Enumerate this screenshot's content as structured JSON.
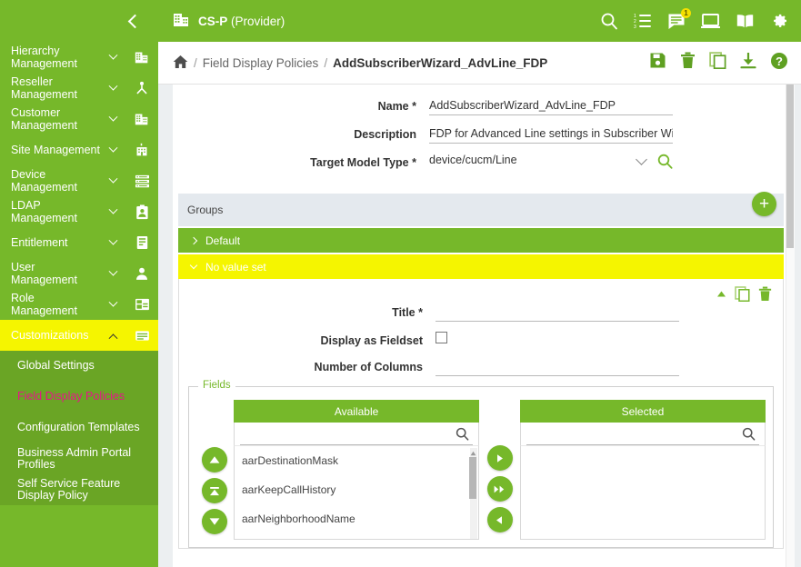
{
  "sidebar": {
    "collapse_icon": "chevron-left-icon",
    "items": [
      {
        "label": "Hierarchy Management",
        "icon": "building-grid-icon",
        "caret": "chevron-down-icon",
        "active": false
      },
      {
        "label": "Reseller Management",
        "icon": "org-tree-icon",
        "caret": "chevron-down-icon",
        "active": false
      },
      {
        "label": "Customer Management",
        "icon": "building-grid-icon",
        "caret": "chevron-down-icon",
        "active": false
      },
      {
        "label": "Site Management",
        "icon": "site-building-icon",
        "caret": "chevron-down-icon",
        "active": false
      },
      {
        "label": "Device Management",
        "icon": "server-list-icon",
        "caret": "chevron-down-icon",
        "active": false
      },
      {
        "label": "LDAP Management",
        "icon": "contact-card-icon",
        "caret": "chevron-down-icon",
        "active": false
      },
      {
        "label": "Entitlement",
        "icon": "entitlement-card-icon",
        "caret": "chevron-down-icon",
        "active": false
      },
      {
        "label": "User Management",
        "icon": "user-icon",
        "caret": "chevron-down-icon",
        "active": false
      },
      {
        "label": "Role Management",
        "icon": "role-window-icon",
        "caret": "chevron-down-icon",
        "active": false
      },
      {
        "label": "Customizations",
        "icon": "customizations-icon",
        "caret": "chevron-up-icon",
        "active": true
      }
    ],
    "subitems": [
      {
        "label": "Global Settings",
        "selected": false
      },
      {
        "label": "Field Display Policies",
        "selected": true
      },
      {
        "label": "Configuration Templates",
        "selected": false
      },
      {
        "label": "Business Admin Portal Profiles",
        "selected": false
      },
      {
        "label": "Self Service Feature Display Policy",
        "selected": false
      }
    ]
  },
  "topbar": {
    "logo_icon": "building-grid-icon",
    "title_bold": "CS-P",
    "title_rest": " (Provider)",
    "icons": [
      {
        "name": "search-icon",
        "badge": ""
      },
      {
        "name": "transactions-list-icon",
        "badge": ""
      },
      {
        "name": "messages-icon",
        "badge": "1"
      },
      {
        "name": "monitor-icon",
        "badge": ""
      },
      {
        "name": "docs-book-icon",
        "badge": ""
      },
      {
        "name": "gear-icon",
        "badge": ""
      }
    ]
  },
  "breadcrumb": {
    "home_icon": "home-icon",
    "sep": "/",
    "parent": "Field Display Policies",
    "current": "AddSubscriberWizard_AdvLine_FDP",
    "actions": [
      {
        "name": "save-icon"
      },
      {
        "name": "delete-icon"
      },
      {
        "name": "clone-icon"
      },
      {
        "name": "export-icon"
      },
      {
        "name": "help-icon"
      }
    ]
  },
  "form": {
    "name": {
      "label": "Name",
      "required": "*",
      "value": "AddSubscriberWizard_AdvLine_FDP"
    },
    "description": {
      "label": "Description",
      "required": "",
      "value": "FDP for Advanced Line settings in Subscriber Wizard"
    },
    "target_model_type": {
      "label": "Target Model Type",
      "required": "*",
      "value": "device/cucm/Line",
      "caret_icon": "chevron-down-icon",
      "search_icon": "search-icon"
    }
  },
  "groups": {
    "header_label": "Groups",
    "add_label": "+",
    "add_icon": "plus-icon",
    "rows": [
      {
        "label": "Default",
        "state": "collapsed",
        "style": "green"
      },
      {
        "label": "No value set",
        "state": "expanded",
        "style": "yellow"
      }
    ],
    "tools": [
      {
        "name": "collapse-caret-icon"
      },
      {
        "name": "clone-icon"
      },
      {
        "name": "delete-icon"
      }
    ],
    "detail": {
      "title": {
        "label": "Title",
        "required": "*",
        "value": ""
      },
      "display_as_fieldset": {
        "label": "Display as Fieldset",
        "checked": false
      },
      "number_of_columns": {
        "label": "Number of Columns",
        "value": ""
      }
    }
  },
  "fields": {
    "legend": "Fields",
    "order_buttons": [
      {
        "name": "move-up-button",
        "icon": "triangle-up-icon"
      },
      {
        "name": "move-top-button",
        "icon": "triangle-up-bar-icon"
      },
      {
        "name": "move-down-button",
        "icon": "triangle-down-icon"
      }
    ],
    "transfer_buttons": [
      {
        "name": "add-selected-button",
        "icon": "triangle-right-icon"
      },
      {
        "name": "add-all-button",
        "icon": "double-triangle-right-icon"
      },
      {
        "name": "remove-selected-button",
        "icon": "triangle-left-icon"
      }
    ],
    "available": {
      "header": "Available",
      "search_value": "",
      "search_placeholder": "",
      "search_icon": "search-icon",
      "items": [
        "aarDestinationMask",
        "aarKeepCallHistory",
        "aarNeighborhoodName"
      ]
    },
    "selected": {
      "header": "Selected",
      "search_value": "",
      "search_placeholder": "",
      "search_icon": "search-icon",
      "items": []
    }
  },
  "colors": {
    "brand_green": "#76b82a",
    "sub_green": "#6aa525",
    "highlight_yellow": "#f5f500",
    "selected_pink": "#e8138a",
    "panel_grey": "#e4e9ee"
  }
}
